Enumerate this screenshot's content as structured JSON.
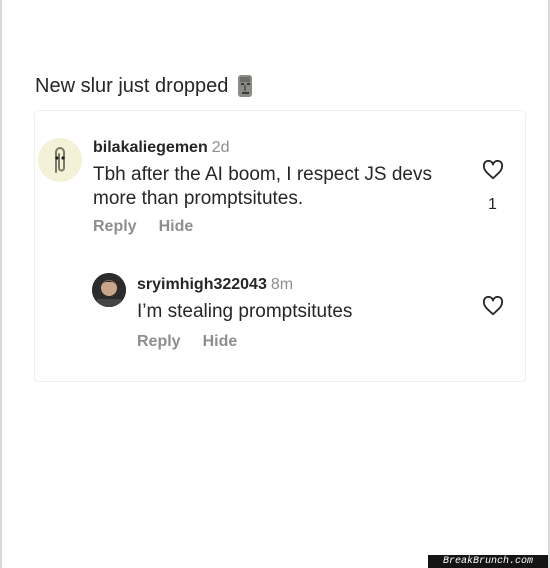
{
  "post": {
    "caption": "New slur just dropped",
    "caption_emoji": "moai-icon"
  },
  "comments": [
    {
      "username": "bilakaliegemen",
      "time": "2d",
      "text": "Tbh after the AI boom, I respect JS devs more than promptsitutes.",
      "reply_label": "Reply",
      "hide_label": "Hide",
      "likes": "1",
      "avatar_icon": "paperclip-icon"
    },
    {
      "username": "sryimhigh322043",
      "time": "8m",
      "text": "I’m stealing promptsitutes",
      "reply_label": "Reply",
      "hide_label": "Hide",
      "avatar_icon": "profile-photo"
    }
  ],
  "watermark": "BreakBrunch.com",
  "colors": {
    "text": "#262626",
    "muted": "#8e8e8e",
    "border": "#efefef"
  }
}
